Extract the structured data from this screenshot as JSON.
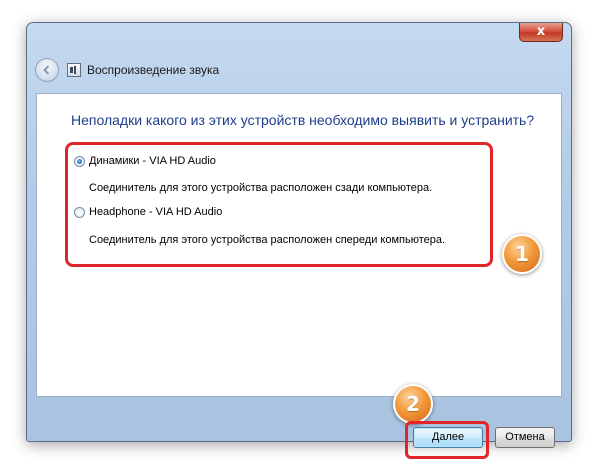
{
  "window": {
    "title": "Воспроизведение звука",
    "close_glyph": "x"
  },
  "question": "Неполадки какого из этих устройств необходимо выявить и устранить?",
  "devices": [
    {
      "name": "Динамики - VIA HD Audio",
      "description": "Соединитель для этого устройства расположен сзади компьютера.",
      "selected": true
    },
    {
      "name": "Headphone - VIA HD Audio",
      "description": "Соединитель для этого устройства расположен спереди компьютера.",
      "selected": false
    }
  ],
  "annotations": {
    "step1": "1",
    "step2": "2",
    "highlight_color": "#e0262b"
  },
  "buttons": {
    "next_mnemonic": "Д",
    "next_rest": "алее",
    "cancel": "Отмена"
  },
  "icons": {
    "back": "back-arrow-icon",
    "app": "sound-app-icon",
    "close": "close-icon"
  }
}
